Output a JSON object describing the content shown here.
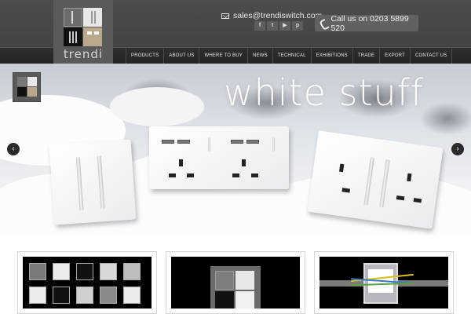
{
  "header": {
    "logo_text": "trendi",
    "email": "sales@trendiswitch.com",
    "phone": "Call us on 0203 5899 520",
    "socials": [
      {
        "name": "facebook",
        "glyph": "f"
      },
      {
        "name": "twitter",
        "glyph": "t"
      },
      {
        "name": "youtube",
        "glyph": "▶"
      },
      {
        "name": "pinterest",
        "glyph": "p"
      }
    ]
  },
  "nav": {
    "items": [
      "PRODUCTS",
      "ABOUT US",
      "WHERE TO BUY",
      "NEWS",
      "TECHNICAL",
      "EXHIBITIONS",
      "TRADE",
      "EXPORT",
      "CONTACT US"
    ]
  },
  "hero": {
    "title": "white stuff",
    "prev_glyph": "‹",
    "next_glyph": "›"
  },
  "colors": {
    "header_bg": "#444444",
    "nav_bg": "#262626",
    "accent_phone_box": "#616161"
  }
}
